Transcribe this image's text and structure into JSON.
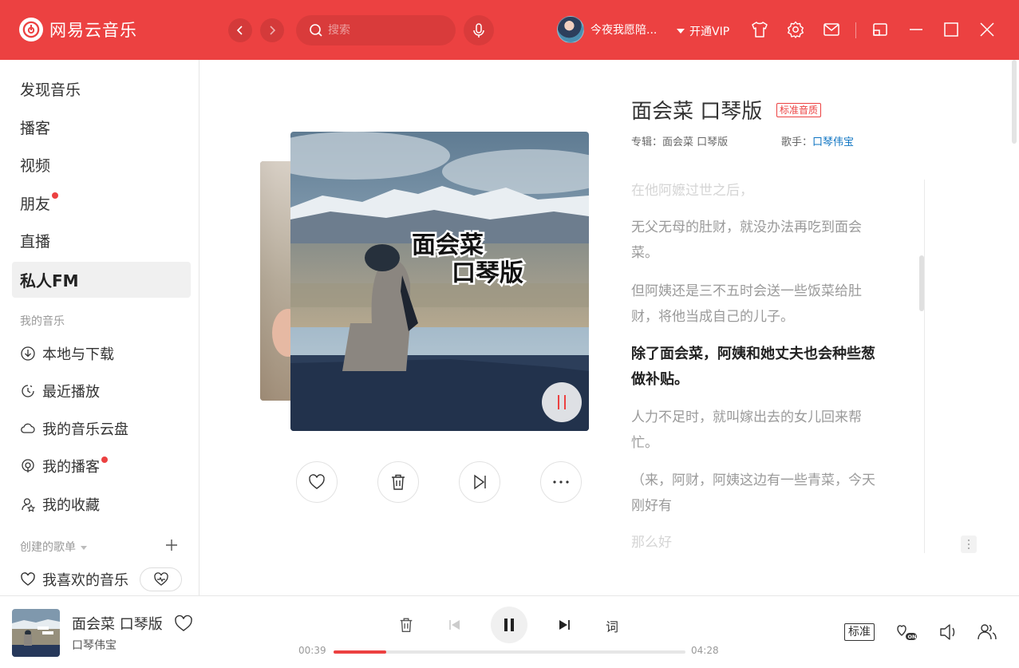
{
  "app": {
    "name": "网易云音乐",
    "accent": "#ec4141"
  },
  "header": {
    "search_placeholder": "搜索",
    "user_name": "今夜我愿陪...",
    "vip_label": "开通VIP",
    "icons": [
      "back-icon",
      "forward-icon",
      "search-icon",
      "mic-icon",
      "skin-icon",
      "settings-icon",
      "mail-icon",
      "mini-mode-icon",
      "minimize-icon",
      "maximize-icon",
      "close-icon"
    ]
  },
  "sidebar": {
    "main_items": [
      {
        "label": "发现音乐"
      },
      {
        "label": "播客"
      },
      {
        "label": "视频"
      },
      {
        "label": "朋友",
        "dot": true
      },
      {
        "label": "直播"
      },
      {
        "label": "私人FM",
        "active": true
      }
    ],
    "my_music_title": "我的音乐",
    "my_music": [
      {
        "label": "本地与下载",
        "icon": "download-icon"
      },
      {
        "label": "最近播放",
        "icon": "history-icon"
      },
      {
        "label": "我的音乐云盘",
        "icon": "cloud-icon"
      },
      {
        "label": "我的播客",
        "icon": "podcast-icon",
        "dot": true
      },
      {
        "label": "我的收藏",
        "icon": "collection-icon"
      }
    ],
    "created_title": "创建的歌单",
    "liked_label": "我喜欢的音乐"
  },
  "fm": {
    "cover_title_line1": "面会菜",
    "cover_title_line2": "口琴版",
    "song_title": "面会菜 口琴版",
    "quality": "标准音质",
    "album_label": "专辑：",
    "album": "面会菜 口琴版",
    "artist_label": "歌手：",
    "artist": "口琴伟宝",
    "lyrics": [
      {
        "text": "在他阿嬷过世之后，",
        "state": "fade"
      },
      {
        "text": "无父无母的肚财，就没办法再吃到面会菜。",
        "state": "normal"
      },
      {
        "text": "但阿姨还是三不五时会送一些饭菜给肚财，将他当成自己的儿子。",
        "state": "normal"
      },
      {
        "text": "除了面会菜，阿姨和她丈夫也会种些葱做补贴。",
        "state": "current"
      },
      {
        "text": "人力不足时，就叫嫁出去的女儿回来帮忙。",
        "state": "normal"
      },
      {
        "text": "（来，阿财，阿姨这边有一些青菜，今天刚好有",
        "state": "normal"
      },
      {
        "text": "那么好",
        "state": "fade"
      }
    ],
    "actions": [
      "like-icon",
      "trash-icon",
      "next-icon",
      "more-icon"
    ]
  },
  "player": {
    "title": "面会菜 口琴版",
    "artist": "口琴伟宝",
    "current_time": "00:39",
    "total_time": "04:28",
    "progress": 0.15,
    "lyric_button": "词",
    "quality_badge": "标准",
    "is_playing": true
  }
}
